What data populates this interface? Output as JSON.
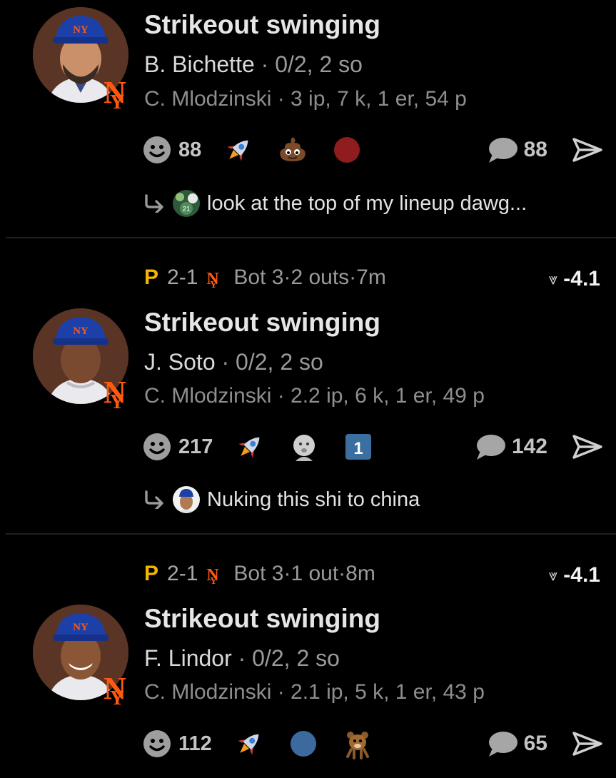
{
  "plays": [
    {
      "title": "Strikeout swinging",
      "batter_name": "B. Bichette",
      "batter_stats": "0/2, 2 so",
      "pitcher_line": "C. Mlodzinski · 3 ip, 7 k, 1 er, 54 p",
      "smiley_count": "88",
      "comment_count": "88",
      "reactions": [
        "rocket",
        "poop",
        "red-circle"
      ],
      "reply_text": "look at the top of my lineup dawg..."
    },
    {
      "team_abbr": "P",
      "score": "2-1",
      "inning": "Bot 3",
      "outs": "2 outs",
      "time_ago": "7m",
      "wpa": "-4.1",
      "title": "Strikeout swinging",
      "batter_name": "J. Soto",
      "batter_stats": "0/2, 2 so",
      "pitcher_line": "C. Mlodzinski · 2.2 ip, 6 k, 1 er, 49 p",
      "smiley_count": "217",
      "comment_count": "142",
      "reactions": [
        "rocket",
        "baby-face",
        "number-one"
      ],
      "reaction_one_label": "1",
      "reply_text": "Nuking this shi to china"
    },
    {
      "team_abbr": "P",
      "score": "2-1",
      "inning": "Bot 3",
      "outs": "1 out",
      "time_ago": "8m",
      "wpa": "-4.1",
      "title": "Strikeout swinging",
      "batter_name": "F. Lindor",
      "batter_stats": "0/2, 2 so",
      "pitcher_line": "C. Mlodzinski · 2.1 ip, 5 k, 1 er, 43 p",
      "smiley_count": "112",
      "comment_count": "65",
      "reactions": [
        "rocket",
        "blue-circle",
        "cartoon-bear"
      ]
    }
  ],
  "separator": " · ",
  "colors": {
    "background": "#000000",
    "pirates_gold": "#f4b400",
    "mets_orange": "#ff5910",
    "mets_blue": "#1d3f8f"
  }
}
